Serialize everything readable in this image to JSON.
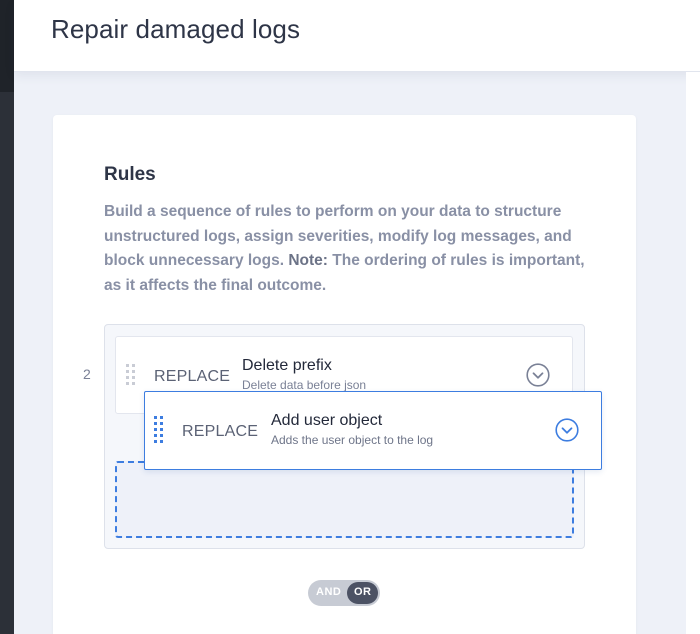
{
  "header": {
    "title": "Repair damaged logs"
  },
  "rules": {
    "title": "Rules",
    "description": "Build a sequence of rules to perform on your data to structure unstructured logs, assign severities, modify log messages, and block unnecessary logs.",
    "note_label": "Note:",
    "note_text": "The ordering of rules is important, as it affects the final outcome.",
    "row_number": "2",
    "items": [
      {
        "type": "REPLACE",
        "name": "Delete prefix",
        "subtitle": "Delete data before json",
        "icon": "chevron-down-circle-icon"
      },
      {
        "type": "REPLACE",
        "name": "Add user object",
        "subtitle": "Adds the user object to the log",
        "icon": "chevron-down-circle-icon",
        "state": "dragging"
      }
    ]
  },
  "logic_toggle": {
    "and_label": "AND",
    "or_label": "OR",
    "selected": "OR"
  },
  "colors": {
    "accent": "#3d7de0",
    "text_dark": "#2e3547",
    "text_muted": "#8990a5"
  }
}
